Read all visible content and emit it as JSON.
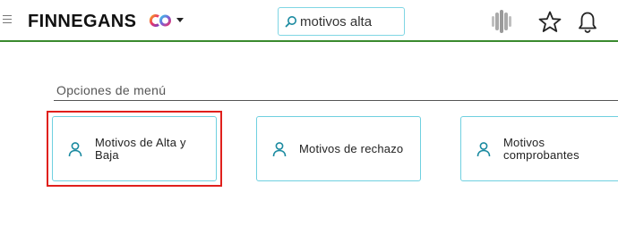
{
  "header": {
    "brand": "FINNEGANS",
    "brand_logo": "co-logo-icon",
    "search": {
      "value": "motivos alta",
      "placeholder": ""
    },
    "icons": [
      "hamburger-icon",
      "search-icon",
      "avatar",
      "star-icon",
      "bell-icon"
    ],
    "accent_color": "#3a8a2e"
  },
  "menu_section": {
    "title": "Opciones de menú",
    "items": [
      {
        "label_line1": "Motivos de Alta y",
        "label_line2": "Baja",
        "icon": "person-icon",
        "highlighted": true
      },
      {
        "label_line1": "Motivos de rechazo",
        "label_line2": "",
        "icon": "person-icon",
        "highlighted": false
      },
      {
        "label_line1": "Motivos",
        "label_line2": "comprobantes",
        "icon": "person-icon",
        "highlighted": false
      }
    ]
  },
  "colors": {
    "card_border": "#6fd0e0",
    "icon": "#1a8aa0",
    "highlight": "#e0201c"
  }
}
